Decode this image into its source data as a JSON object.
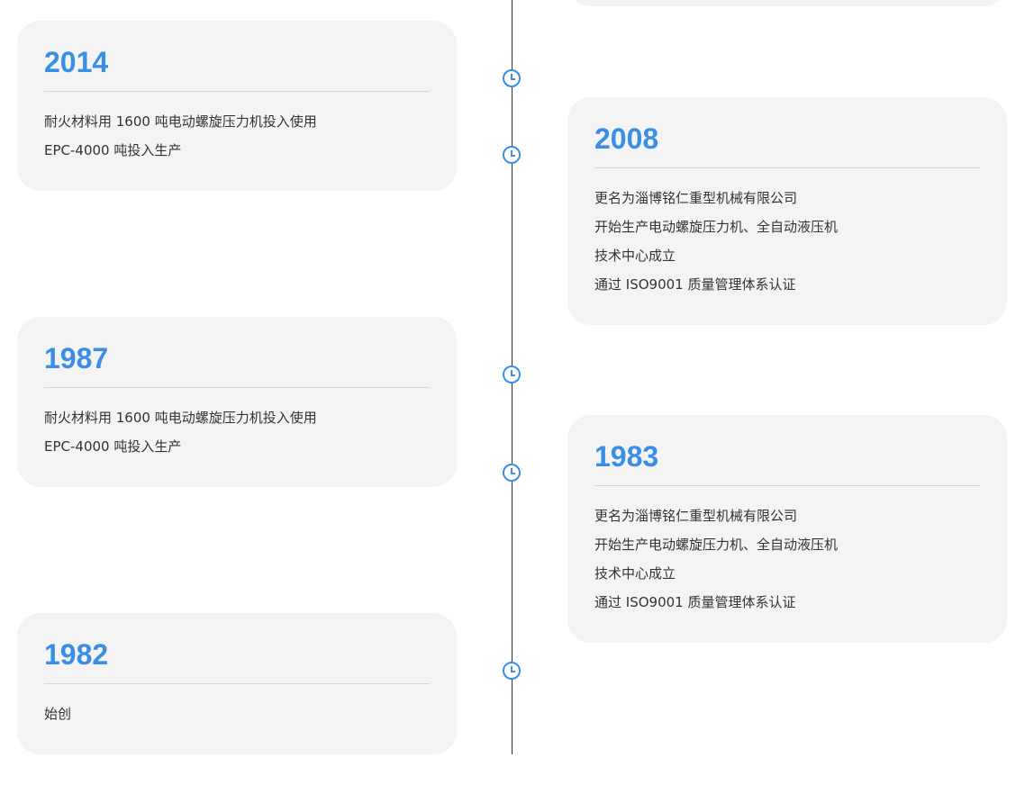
{
  "timeline": {
    "entries": [
      {
        "year": "2014",
        "lines": [
          "耐火材料用 1600 吨电动螺旋压力机投入使用",
          "EPC-4000 吨投入生产"
        ]
      },
      {
        "year": "2008",
        "lines": [
          "更名为淄博铭仁重型机械有限公司",
          "开始生产电动螺旋压力机、全自动液压机",
          "技术中心成立",
          "通过 ISO9001 质量管理体系认证"
        ]
      },
      {
        "year": "1987",
        "lines": [
          "耐火材料用 1600 吨电动螺旋压力机投入使用",
          "EPC-4000 吨投入生产"
        ]
      },
      {
        "year": "1983",
        "lines": [
          "更名为淄博铭仁重型机械有限公司",
          "开始生产电动螺旋压力机、全自动液压机",
          "技术中心成立",
          "通过 ISO9001 质量管理体系认证"
        ]
      },
      {
        "year": "1982",
        "lines": [
          "始创"
        ]
      }
    ]
  },
  "icons": {
    "timeline_marker": "clock-icon"
  },
  "colors": {
    "accent": "#3a8ee6",
    "card_background": "#f4f4f4",
    "text": "#333333"
  }
}
